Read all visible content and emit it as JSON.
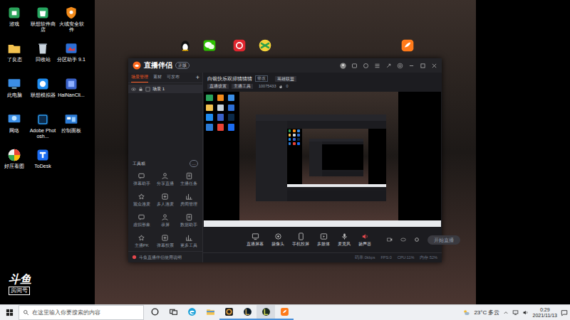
{
  "desktop_icons": [
    {
      "label": "游戏"
    },
    {
      "label": "联想软件商店"
    },
    {
      "label": "火绒安全软件"
    },
    {
      "label": "了良态"
    },
    {
      "label": "回收站"
    },
    {
      "label": "分区助手 9.1"
    },
    {
      "label": "此电脑"
    },
    {
      "label": "联想模拟器"
    },
    {
      "label": "HaiNanCli..."
    },
    {
      "label": "网络"
    },
    {
      "label": "Adobe Photosh..."
    },
    {
      "label": "控制面板"
    },
    {
      "label": "好压看图"
    },
    {
      "label": "ToDesk"
    }
  ],
  "watermark": {
    "logo": "斗鱼",
    "room": "房间号"
  },
  "app_window": {
    "title": "直播伴侣",
    "badge": "正版",
    "left_tabs": [
      {
        "label": "场景管理",
        "selected": true
      },
      {
        "label": "素材",
        "selected": false
      },
      {
        "label": "可发布",
        "selected": false
      }
    ],
    "add": "+",
    "scenes": [
      {
        "name": "场景 1",
        "selected": true
      }
    ],
    "toolbox": {
      "title": "工具箱",
      "more": "…",
      "tools": [
        {
          "label": "弹幕助手"
        },
        {
          "label": "分享直播"
        },
        {
          "label": "主播任务"
        },
        {
          "label": "观众连麦"
        },
        {
          "label": "多人连麦"
        },
        {
          "label": "房间管理"
        },
        {
          "label": "虚拟形象"
        },
        {
          "label": "录屏"
        },
        {
          "label": "数据助手"
        },
        {
          "label": "主播PK"
        },
        {
          "label": "弹幕投票"
        },
        {
          "label": "更多工具"
        }
      ]
    },
    "notice": "斗鱼直播伴侣使用说明",
    "room": {
      "title": "白银快乐双排猜猜猜",
      "edit": "修改",
      "category": "英雄联盟",
      "tags": [
        "直播设置",
        "主播工具"
      ],
      "room_id": "10075433",
      "likes": "0"
    },
    "toolbar": [
      {
        "label": "直播屏幕"
      },
      {
        "label": "摄像头"
      },
      {
        "label": "手机投屏"
      },
      {
        "label": "多媒体"
      },
      {
        "label": "麦克风"
      },
      {
        "label": "扬声器"
      }
    ],
    "start_button": "开始直播",
    "status": [
      "码率:0kbps",
      "FPS:0",
      "CPU:11%",
      "内存:52%"
    ]
  },
  "taskbar": {
    "search_placeholder": "在这里输入你要搜索的内容",
    "apps": [
      {
        "running": false,
        "selected": false
      },
      {
        "running": false,
        "selected": false
      },
      {
        "running": false,
        "selected": false
      },
      {
        "running": false,
        "selected": false
      },
      {
        "running": true,
        "selected": false
      },
      {
        "running": true,
        "selected": false
      },
      {
        "running": true,
        "selected": true
      },
      {
        "running": true,
        "selected": false
      }
    ],
    "weather": "23°C 多云",
    "time": "0:29",
    "date": "2021/11/13"
  }
}
